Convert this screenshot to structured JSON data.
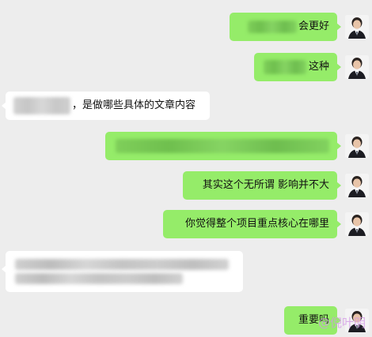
{
  "messages": [
    {
      "side": "out",
      "visible_text": "会更好"
    },
    {
      "side": "out",
      "visible_text": "这种"
    },
    {
      "side": "in",
      "visible_text": "，是做哪些具体的文章内容"
    },
    {
      "side": "out",
      "visible_text": ""
    },
    {
      "side": "out",
      "visible_text": "其实这个无所谓 影响并不大"
    },
    {
      "side": "out",
      "visible_text": "你觉得整个项目重点核心在哪里"
    },
    {
      "side": "in",
      "visible_text": ""
    },
    {
      "side": "out",
      "visible_text": "重要吗"
    }
  ],
  "watermark": "@倪叶明",
  "colors": {
    "background": "#ededed",
    "outgoing_bubble": "#95ec69",
    "incoming_bubble": "#ffffff"
  }
}
